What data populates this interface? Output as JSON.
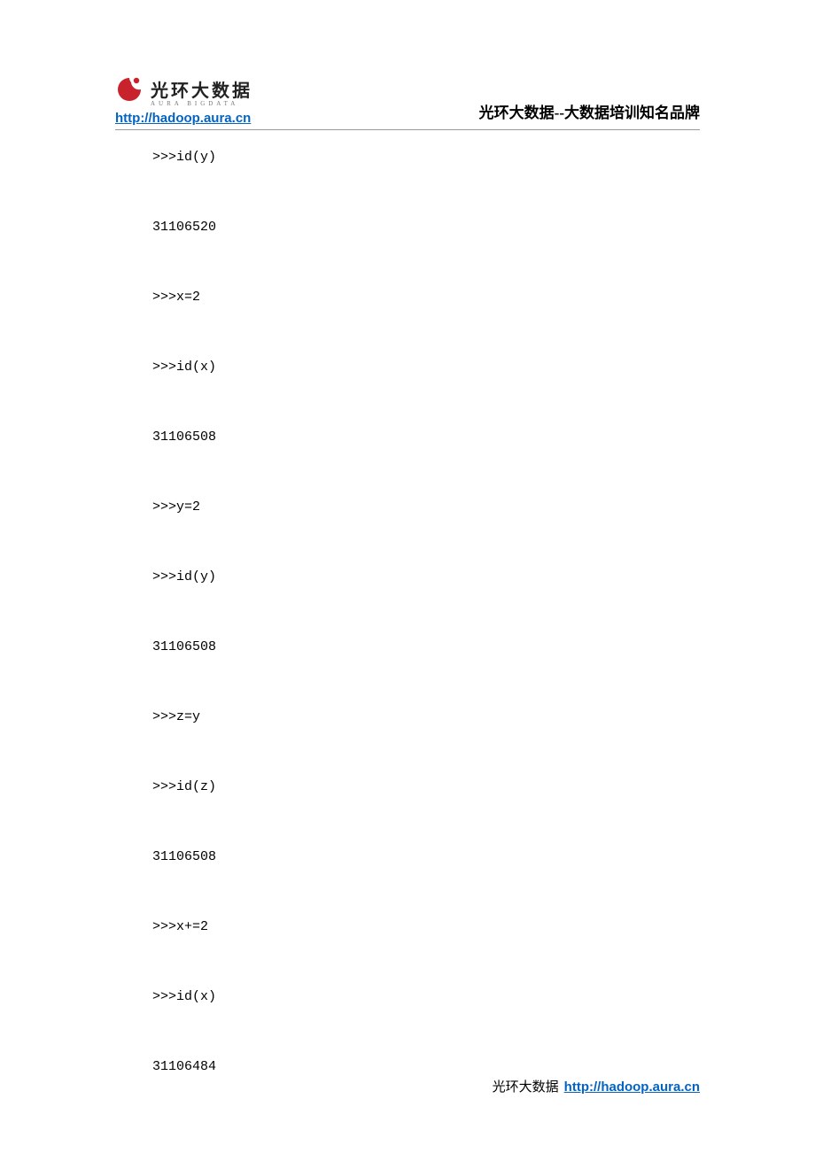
{
  "header": {
    "logo_cn": "光环大数据",
    "logo_en": "AURA  BIGDATA",
    "link": "http://hadoop.aura.cn",
    "brand": "光环大数据--大数据培训知名品牌"
  },
  "code_lines": [
    ">>>id(y)",
    "31106520",
    ">>>x=2",
    ">>>id(x)",
    "31106508",
    ">>>y=2",
    ">>>id(y)",
    "31106508",
    ">>>z=y",
    ">>>id(z)",
    "31106508",
    ">>>x+=2",
    ">>>id(x)",
    "31106484"
  ],
  "footer": {
    "text": "光环大数据",
    "link": "http://hadoop.aura.cn"
  }
}
